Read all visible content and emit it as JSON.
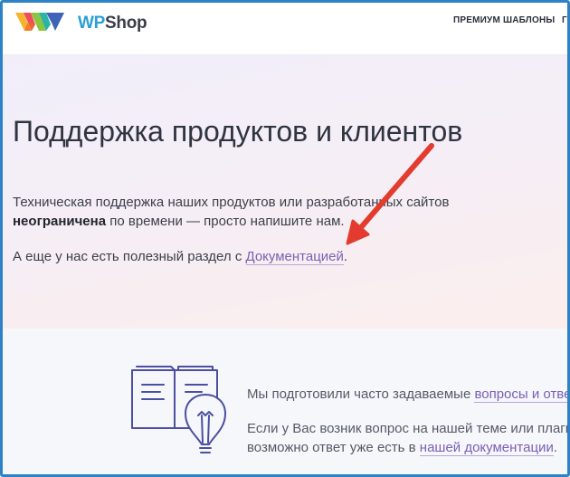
{
  "header": {
    "logo": {
      "wp": "WP",
      "shop": "Shop"
    },
    "nav": {
      "premium": "ПРЕМИУМ ШАБЛОНЫ",
      "cut": "Г"
    }
  },
  "hero": {
    "title": "Поддержка продуктов и клиентов",
    "p1_start": "Техническая поддержка наших продуктов или разработанных сайтов",
    "p1_bold": "неограничена",
    "p1_end": " по времени — просто напишите нам.",
    "p2_start": "А еще у нас есть полезный раздел с ",
    "p2_link": "Документацией",
    "p2_end": "."
  },
  "faq": {
    "line1_start": "Мы подготовили часто задаваемые ",
    "line1_link": "вопросы и отве",
    "line2": "Если у Вас возник вопрос на нашей теме или плагин",
    "line3_start": "возможно ответ уже есть в ",
    "line3_link": "нашей документации",
    "line3_end": "."
  },
  "colors": {
    "frame_border": "#2d82c7",
    "link": "#7a5fb5",
    "arrow": "#e33b2e",
    "illustration_stroke": "#4b4f9e",
    "logo_wp": "#2a9fd6"
  },
  "icons": {
    "logo": "wpshop-logo-icon",
    "illustration": "book-lightbulb-icon",
    "annotation": "red-arrow-icon"
  }
}
